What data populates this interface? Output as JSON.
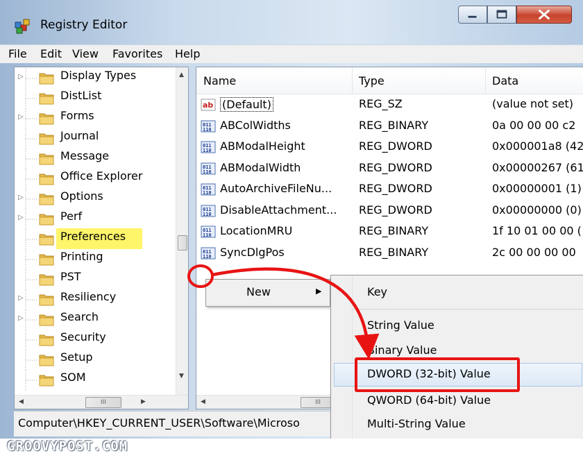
{
  "window": {
    "title": "Registry Editor"
  },
  "menubar": [
    "File",
    "Edit",
    "View",
    "Favorites",
    "Help"
  ],
  "tree": {
    "items": [
      {
        "label": "Display Types",
        "expandable": true
      },
      {
        "label": "DistList",
        "expandable": false
      },
      {
        "label": "Forms",
        "expandable": true
      },
      {
        "label": "Journal",
        "expandable": false
      },
      {
        "label": "Message",
        "expandable": false
      },
      {
        "label": "Office Explorer",
        "expandable": false
      },
      {
        "label": "Options",
        "expandable": true
      },
      {
        "label": "Perf",
        "expandable": true
      },
      {
        "label": "Preferences",
        "expandable": false,
        "highlighted": true
      },
      {
        "label": "Printing",
        "expandable": false
      },
      {
        "label": "PST",
        "expandable": false
      },
      {
        "label": "Resiliency",
        "expandable": true
      },
      {
        "label": "Search",
        "expandable": true
      },
      {
        "label": "Security",
        "expandable": false
      },
      {
        "label": "Setup",
        "expandable": false
      },
      {
        "label": "SOM",
        "expandable": false
      }
    ],
    "hscroll_label": "III"
  },
  "list": {
    "columns": [
      "Name",
      "Type",
      "Data"
    ],
    "rows": [
      {
        "icon": "string-value-icon",
        "name": "(Default)",
        "type": "REG_SZ",
        "data": "(value not set)"
      },
      {
        "icon": "binary-value-icon",
        "name": "ABColWidths",
        "type": "REG_BINARY",
        "data": "0a 00 00 00 c2"
      },
      {
        "icon": "binary-value-icon",
        "name": "ABModalHeight",
        "type": "REG_DWORD",
        "data": "0x000001a8 (42"
      },
      {
        "icon": "binary-value-icon",
        "name": "ABModalWidth",
        "type": "REG_DWORD",
        "data": "0x00000267 (61"
      },
      {
        "icon": "binary-value-icon",
        "name": "AutoArchiveFileNu...",
        "type": "REG_DWORD",
        "data": "0x00000001 (1)"
      },
      {
        "icon": "binary-value-icon",
        "name": "DisableAttachment...",
        "type": "REG_DWORD",
        "data": "0x00000000 (0)"
      },
      {
        "icon": "binary-value-icon",
        "name": "LocationMRU",
        "type": "REG_BINARY",
        "data": "1f 10 01 00 00 ("
      },
      {
        "icon": "binary-value-icon",
        "name": "SyncDlgPos",
        "type": "REG_BINARY",
        "data": "2c 00 00 00 00"
      }
    ],
    "hscroll_label": "III"
  },
  "statusbar": {
    "path": "Computer\\HKEY_CURRENT_USER\\Software\\Microso"
  },
  "context_menu": {
    "item": "New"
  },
  "submenu": {
    "items": [
      "Key",
      "String Value",
      "Binary Value",
      "DWORD (32-bit) Value",
      "QWORD (64-bit) Value",
      "Multi-String Value"
    ],
    "selected": "DWORD (32-bit) Value"
  },
  "annotation_color": "#e81414",
  "watermark": "GROOVYPOST.COM"
}
